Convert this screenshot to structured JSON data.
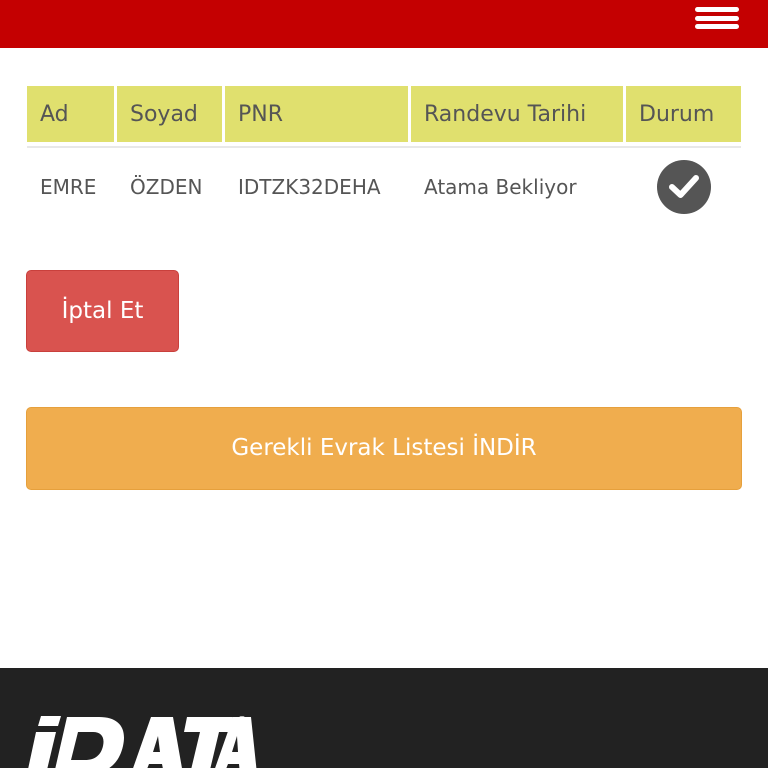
{
  "header": {
    "menu_icon": "hamburger-menu-icon",
    "bar_color": "#c40001"
  },
  "table": {
    "columns": [
      "Ad",
      "Soyad",
      "PNR",
      "Randevu Tarihi",
      "Durum"
    ],
    "header_color": "#e0e06e",
    "rows": [
      {
        "ad": "EMRE",
        "soyad": "ÖZDEN",
        "pnr": "IDTZK32DEHA",
        "randevu_tarihi": "Atama Bekliyor",
        "durum_icon": "check-circle-icon"
      }
    ]
  },
  "actions": {
    "cancel_label": "İptal Et",
    "cancel_color": "#d9534f",
    "download_label": "Gerekli Evrak Listesi İNDİR",
    "download_color": "#f0ad4e"
  },
  "footer": {
    "logo_text": "iDATA",
    "logo_mark": "®",
    "background": "#222222"
  }
}
